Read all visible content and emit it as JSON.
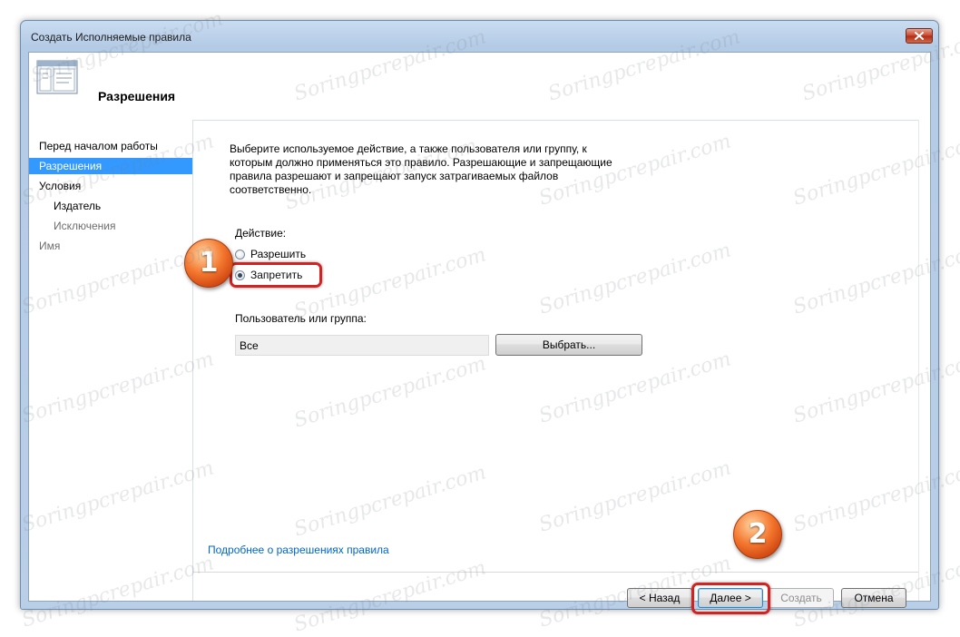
{
  "window": {
    "title": "Создать Исполняемые правила"
  },
  "header": {
    "title": "Разрешения"
  },
  "sidebar": {
    "items": [
      {
        "label": "Перед началом работы",
        "state": "normal"
      },
      {
        "label": "Разрешения",
        "state": "active"
      },
      {
        "label": "Условия",
        "state": "normal"
      },
      {
        "label": "Издатель",
        "state": "sub"
      },
      {
        "label": "Исключения",
        "state": "sub-dim"
      },
      {
        "label": "Имя",
        "state": "dim"
      }
    ]
  },
  "main": {
    "description": "Выберите используемое действие, а также пользователя или группу, к которым должно применяться это правило. Разрешающие и запрещающие правила разрешают и запрещают запуск затрагиваемых файлов соответственно.",
    "action_label": "Действие:",
    "radio_allow": "Разрешить",
    "radio_deny": "Запретить",
    "selected_action": "Запретить",
    "user_group_label": "Пользователь или группа:",
    "user_group_value": "Все",
    "select_button": "Выбрать...",
    "help_link": "Подробнее о разрешениях правила"
  },
  "footer": {
    "back": "< Назад",
    "next": "Далее >",
    "create": "Создать",
    "cancel": "Отмена"
  },
  "callouts": {
    "first": "1",
    "second": "2"
  },
  "watermark": "Soringpcrepair.com",
  "colors": {
    "highlight": "#3399ff",
    "callout": "#f4772e",
    "focus_frame": "#d32222",
    "link": "#0066cc"
  }
}
